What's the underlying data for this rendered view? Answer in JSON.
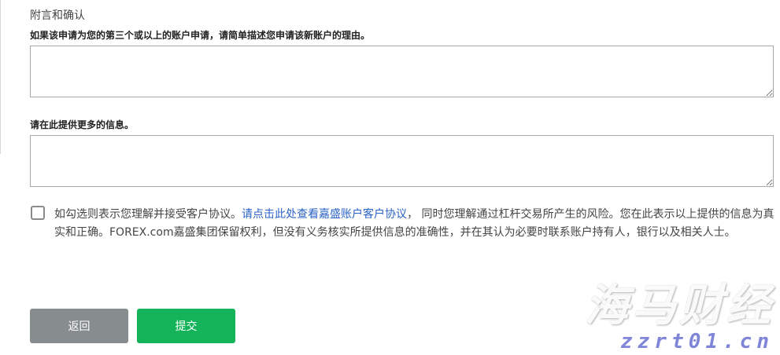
{
  "form": {
    "section_title": "附言和确认",
    "reason_label": "如果该申请为您的第三个或以上的账户申请，请简单描述您申请该新账户的理由。",
    "reason_value": "",
    "more_info_label": "请在此提供更多的信息。",
    "more_info_value": "",
    "agreement": {
      "text_before": "如勾选则表示您理解并接受客户协议。",
      "link": "请点击此处查看嘉盛账户客户协议",
      "text_after": "， 同时您理解通过杠杆交易所产生的风险。您在此表示以上提供的信息为真实和正确。FOREX.com嘉盛集团保留权利，但没有义务核实所提供信息的准确性，并在其认为必要时联系账户持有人，银行以及相关人士。",
      "checked": false
    },
    "buttons": {
      "back_label": "返回",
      "submit_label": "提交"
    }
  },
  "watermark": {
    "title": "海马财经",
    "url": "zzrt01.cn"
  },
  "colors": {
    "submit": "#15b45a",
    "back": "#878d8e",
    "link": "#2b63c6"
  }
}
